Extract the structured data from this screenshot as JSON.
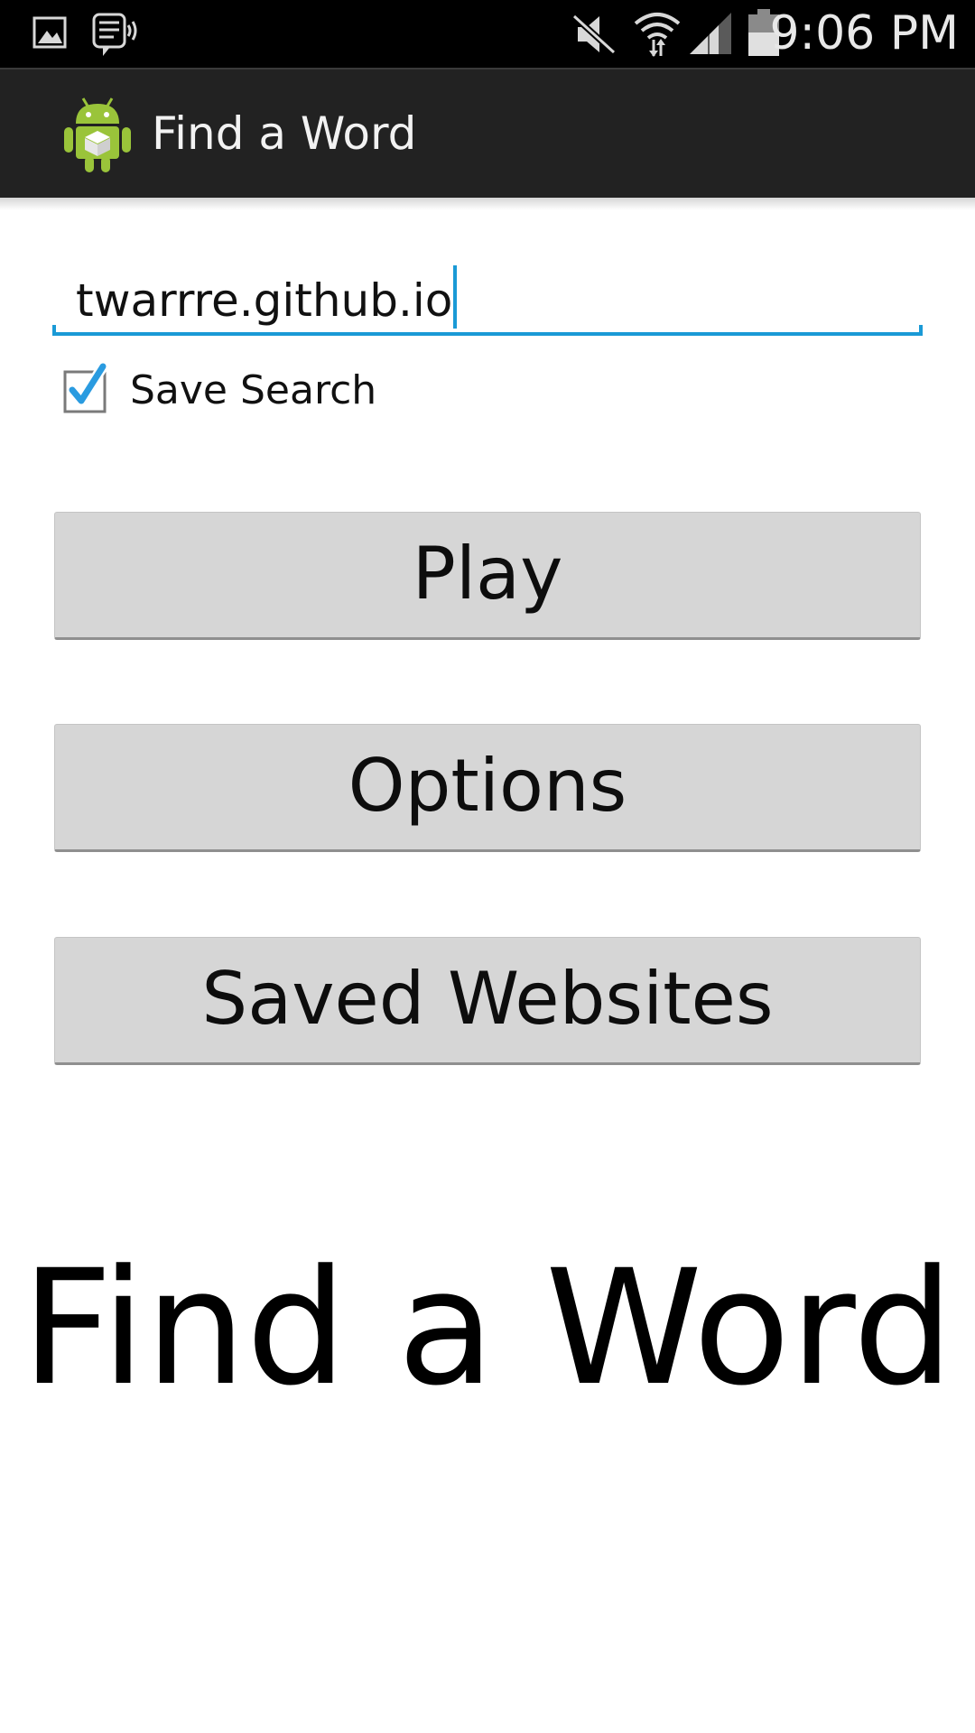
{
  "status_bar": {
    "time": "9:06 PM",
    "icons": [
      "gallery-icon",
      "voicemail-icon",
      "mute-icon",
      "wifi-icon",
      "signal-icon",
      "battery-icon"
    ]
  },
  "action_bar": {
    "app_icon": "android-app-icon",
    "title": "Find a Word",
    "background_color": "#222222"
  },
  "search": {
    "value": "twarrre.github.io",
    "accent_color": "#1a9ad6"
  },
  "save_search": {
    "label": "Save Search",
    "checked": true
  },
  "buttons": {
    "play": "Play",
    "options": "Options",
    "saved_websites": "Saved Websites",
    "background_color": "#d6d6d6"
  },
  "banner": {
    "title": "Find a Word"
  }
}
